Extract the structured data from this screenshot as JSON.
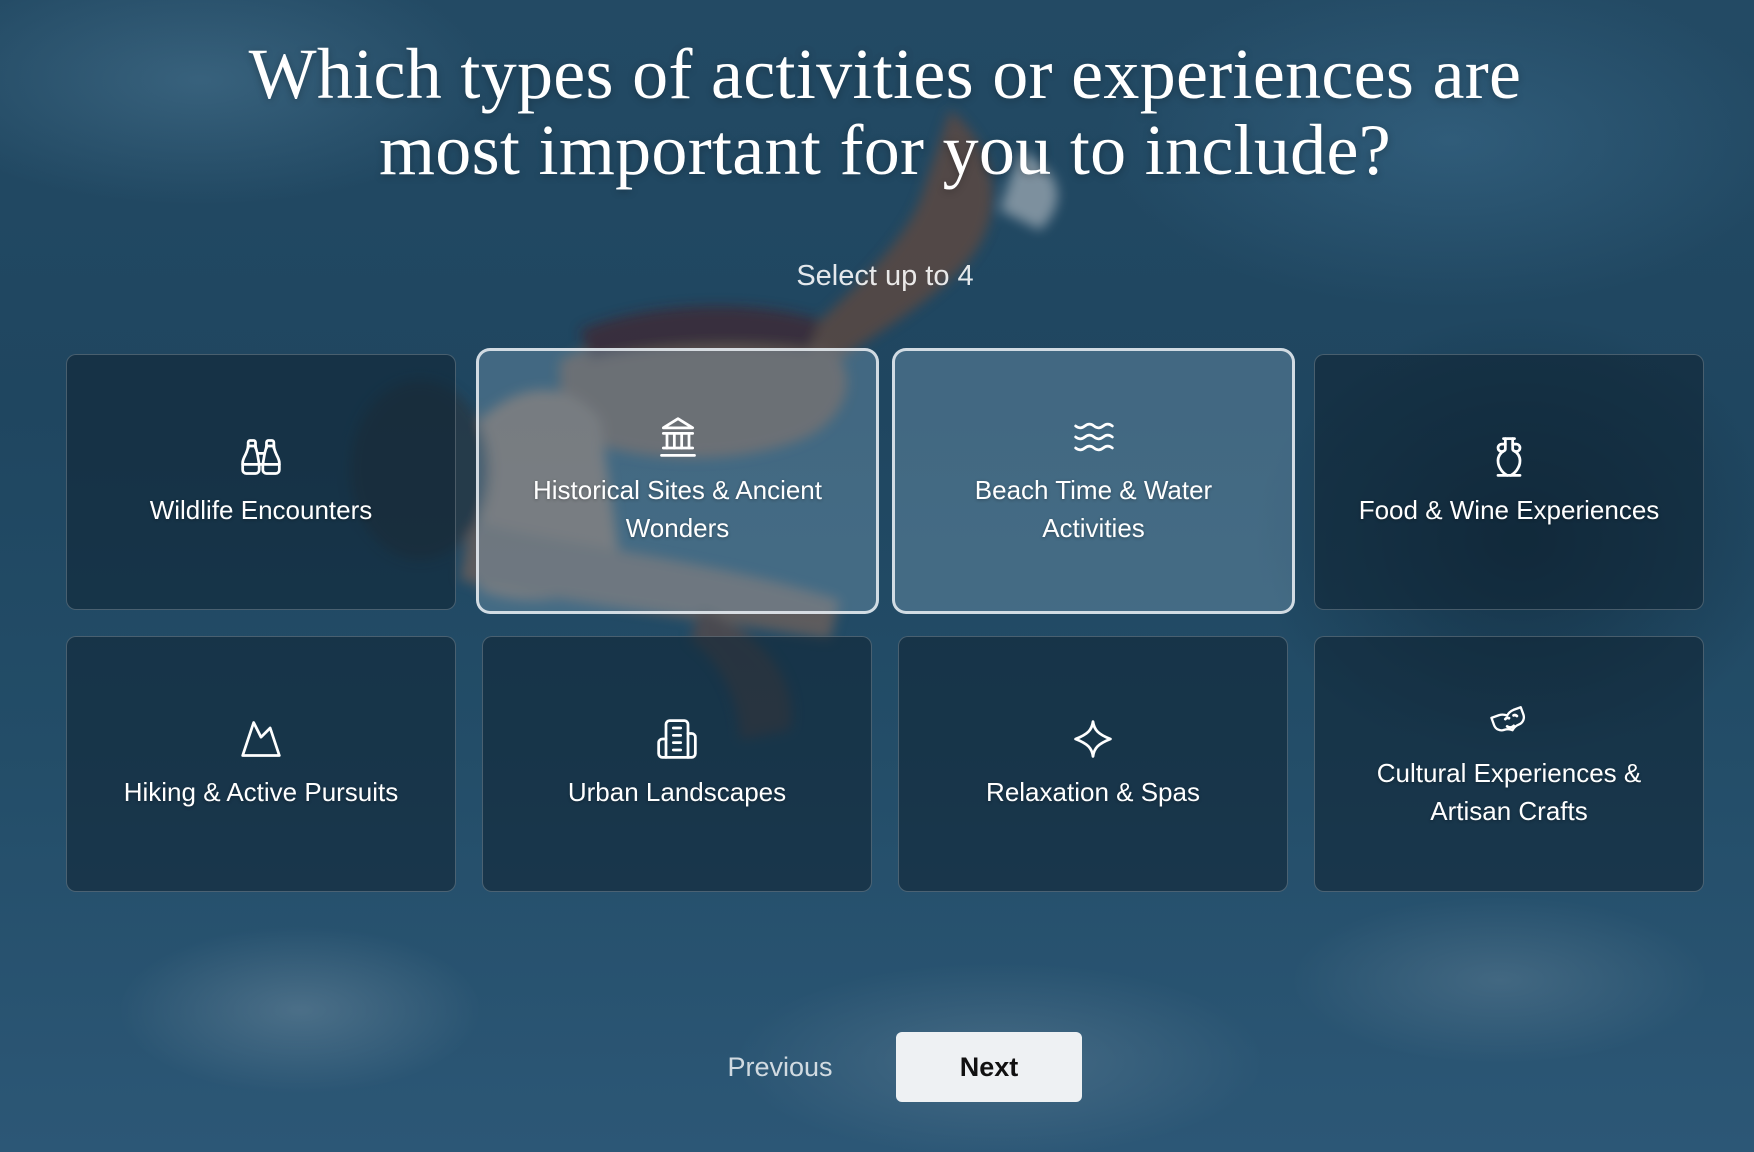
{
  "question": {
    "title_line1": "Which types of activities or experiences are",
    "title_line2": "most important for you to include?",
    "instruction": "Select up to 4"
  },
  "options": [
    {
      "label": "Wildlife Encounters",
      "icon": "binoculars-icon",
      "selected": false
    },
    {
      "label": "Historical Sites & Ancient Wonders",
      "icon": "landmark-icon",
      "selected": true
    },
    {
      "label": "Beach Time & Water Activities",
      "icon": "waves-icon",
      "selected": true
    },
    {
      "label": "Food & Wine Experiences",
      "icon": "amphora-icon",
      "selected": false
    },
    {
      "label": "Hiking & Active Pursuits",
      "icon": "mountain-icon",
      "selected": false
    },
    {
      "label": "Urban Landscapes",
      "icon": "building-icon",
      "selected": false
    },
    {
      "label": "Relaxation & Spas",
      "icon": "sparkle-icon",
      "selected": false
    },
    {
      "label": "Cultural Experiences & Artisan Crafts",
      "icon": "theater-masks-icon",
      "selected": false
    }
  ],
  "navigation": {
    "previous_label": "Previous",
    "next_label": "Next"
  },
  "colors": {
    "background": "#234a64",
    "selected_border": "#ebf0f5",
    "next_button_bg": "#eef1f3"
  }
}
